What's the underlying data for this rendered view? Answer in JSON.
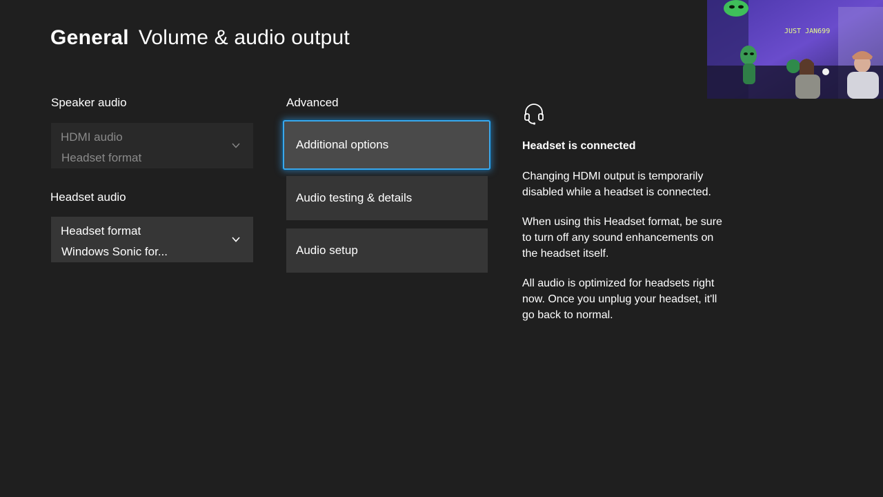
{
  "header": {
    "section": "General",
    "page": "Volume & audio output"
  },
  "left": {
    "speaker_audio_label": "Speaker audio",
    "speaker_dropdown": {
      "line1": "HDMI audio",
      "line2": "Headset format",
      "state": "disabled"
    },
    "headset_audio_label": "Headset audio",
    "headset_dropdown": {
      "line1": "Headset format",
      "line2": "Windows Sonic for..."
    }
  },
  "advanced": {
    "label": "Advanced",
    "buttons": [
      {
        "label": "Additional options",
        "focused": true
      },
      {
        "label": "Audio testing & details",
        "focused": false
      },
      {
        "label": "Audio setup",
        "focused": false
      }
    ]
  },
  "info": {
    "icon": "headset-icon",
    "title": "Headset is connected",
    "paragraphs": [
      "Changing HDMI output is temporarily disabled while a headset is connected.",
      "When using this Headset format, be sure to turn off any sound enhancements on the headset itself.",
      "All audio is optimized for headsets right now. Once you unplug your headset, it'll go back to normal."
    ]
  },
  "webcam": {
    "sign_text": "JUST JAN699"
  },
  "colors": {
    "background": "#1f1f1f",
    "tile": "#363636",
    "tile_focused": "#4a4a4a",
    "focus_ring": "#3aa8ec",
    "disabled_text": "#8a8a8a"
  }
}
